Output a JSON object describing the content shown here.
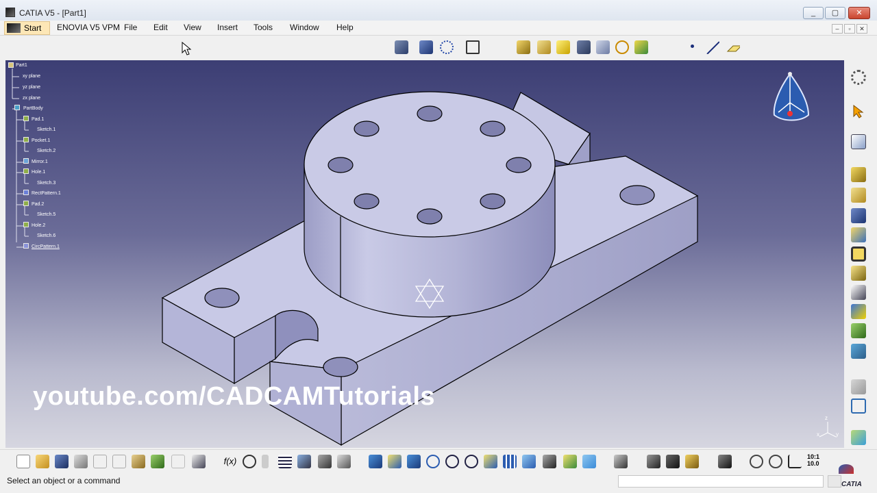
{
  "window": {
    "title": "CATIA V5 - [Part1]",
    "controls": [
      "_",
      "▢",
      "✕"
    ]
  },
  "menu": {
    "start": "Start",
    "items": [
      "ENOVIA V5 VPM",
      "File",
      "Edit",
      "View",
      "Insert",
      "Tools",
      "Window",
      "Help"
    ]
  },
  "mdi_controls": [
    "–",
    "▫",
    "✕"
  ],
  "tree": {
    "nodes": [
      {
        "label": "Part1",
        "level": 0
      },
      {
        "label": "xy plane",
        "level": 1
      },
      {
        "label": "yz plane",
        "level": 1
      },
      {
        "label": "zx plane",
        "level": 1
      },
      {
        "label": "PartBody",
        "level": 1
      },
      {
        "label": "Pad.1",
        "level": 2
      },
      {
        "label": "Sketch.1",
        "level": 3
      },
      {
        "label": "Pocket.1",
        "level": 2
      },
      {
        "label": "Sketch.2",
        "level": 3
      },
      {
        "label": "Mirror.1",
        "level": 2
      },
      {
        "label": "Hole.1",
        "level": 2
      },
      {
        "label": "Sketch.3",
        "level": 3
      },
      {
        "label": "RectPattern.1",
        "level": 2
      },
      {
        "label": "Pad.2",
        "level": 2
      },
      {
        "label": "Sketch.5",
        "level": 3
      },
      {
        "label": "Hole.2",
        "level": 2
      },
      {
        "label": "Sketch.6",
        "level": 3
      },
      {
        "label": "CircPattern.1",
        "level": 2,
        "selected": true
      }
    ]
  },
  "watermark": "youtube.com/CADCAMTutorials",
  "compass_axes": {
    "z": "z",
    "x": "x",
    "y": "y"
  },
  "status": {
    "prompt": "Select an object or a command",
    "brand": "CATIA",
    "zoom_label_top": "10:1",
    "zoom_label_bottom": "10.0"
  },
  "colors": {
    "viewport_top": "#3c3e74",
    "viewport_bottom": "#d6d6e0",
    "part_face_light": "#cacbe6",
    "part_face_mid": "#b2b3d6",
    "part_face_dark": "#9798c2",
    "start_highlight": "#fde7b6"
  },
  "icons": {
    "top_toolbar": [
      "sketcher-icon",
      "knowledge-icon",
      "product-icon",
      "fit-all-icon",
      "sketcher-tools-icon",
      "pad-icon",
      "pocket-icon",
      "shaft-icon",
      "groove-icon",
      "hole-icon",
      "rib-icon",
      "point-icon",
      "line-icon",
      "plane-icon"
    ],
    "right_toolbar": [
      "settings-icon",
      "select-icon",
      "sketch-icon",
      "pad-icon",
      "pocket-icon",
      "shaft-icon",
      "hole-icon",
      "fillet-icon",
      "chamfer-icon",
      "draft-icon",
      "shell-icon",
      "thickness-icon",
      "mirror-icon",
      "pattern-icon",
      "material-icon"
    ],
    "bottom_toolbar": [
      "new-icon",
      "open-icon",
      "save-icon",
      "print-icon",
      "cut-icon",
      "copy-icon",
      "paste-icon",
      "undo-icon",
      "redo-icon",
      "whats-this-icon",
      "formula-icon",
      "comment-icon",
      "measure-icon",
      "table-icon",
      "hierarchy-icon",
      "check-icon",
      "analysis-icon",
      "fly-icon",
      "fit-all-icon",
      "pan-icon",
      "rotate-icon",
      "zoom-in-icon",
      "zoom-out-icon",
      "normal-view-icon",
      "multi-view-icon",
      "iso-view-icon",
      "shading-icon",
      "hide-show-icon",
      "swap-icon",
      "view-mode-icon",
      "rename-icon",
      "measure-between-icon",
      "measure-item-icon",
      "mass-icon",
      "capture-icon",
      "cycle-icon",
      "hand-icon",
      "axis-icon",
      "scale-icon"
    ]
  }
}
